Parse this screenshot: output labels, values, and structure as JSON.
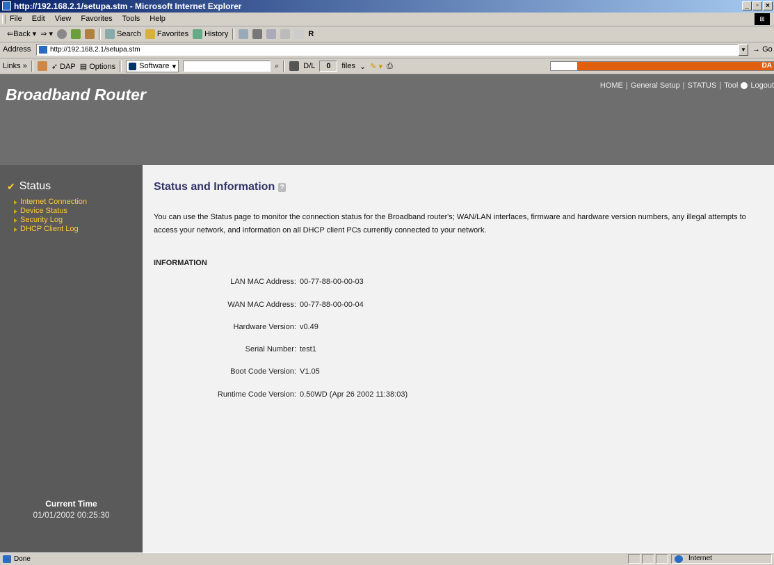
{
  "window": {
    "title": "http://192.168.2.1/setupa.stm - Microsoft Internet Explorer",
    "controls": [
      "_",
      "▫",
      "×"
    ]
  },
  "menu": [
    "File",
    "Edit",
    "View",
    "Favorites",
    "Tools",
    "Help"
  ],
  "toolbar": {
    "back": "⇐Back",
    "search": "Search",
    "favorites": "Favorites",
    "history": "History"
  },
  "address": {
    "label": "Address",
    "url": "http://192.168.2.1/setupa.stm",
    "go": "Go"
  },
  "links_bar": {
    "links": "Links »",
    "dap": "DAP",
    "options": "Options",
    "software": "Software",
    "dl_label": "D/L",
    "dl_value": "0",
    "files": "files",
    "brand": "DA"
  },
  "header": {
    "brand": "Broadband Router",
    "nav": [
      "HOME",
      "General Setup",
      "STATUS",
      "Tool",
      "Logout"
    ]
  },
  "sidebar": {
    "title": "Status",
    "items": [
      "Internet Connection",
      "Device Status",
      "Security Log",
      "DHCP Client Log"
    ],
    "time_label": "Current Time",
    "time_value": "01/01/2002 00:25:30"
  },
  "main": {
    "title": "Status and Information",
    "intro": "You can use the Status page to monitor the connection status for the Broadband router's; WAN/LAN interfaces, firmware and hardware version numbers, any illegal attempts to access your network, and information on all DHCP client PCs currently connected to your network.",
    "section": "INFORMATION",
    "rows": [
      {
        "label": "LAN MAC Address:",
        "value": "00-77-88-00-00-03"
      },
      {
        "label": "WAN MAC Address:",
        "value": "00-77-88-00-00-04"
      },
      {
        "label": "Hardware Version:",
        "value": "v0.49"
      },
      {
        "label": "Serial Number:",
        "value": "test1"
      },
      {
        "label": "Boot Code Version:",
        "value": "V1.05"
      },
      {
        "label": "Runtime Code Version:",
        "value": "0.50WD (Apr 26 2002 11:38:03)"
      }
    ]
  },
  "status": {
    "text": "Done",
    "zone": "Internet"
  }
}
